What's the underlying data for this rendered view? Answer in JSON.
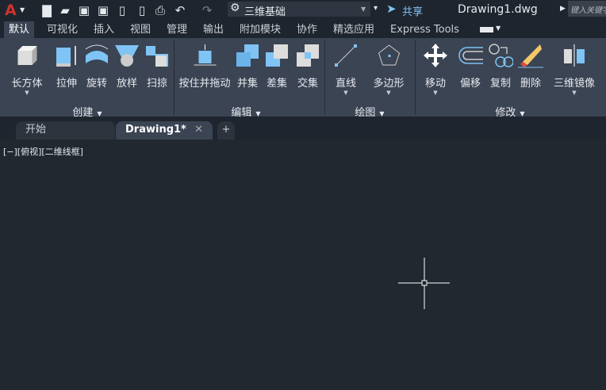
{
  "titlebar": {
    "app_logo": "A",
    "workspace": "三维基础",
    "share": "共享",
    "doc_title": "Drawing1.dwg",
    "search_placeholder": "键入关键字"
  },
  "ribbon_tabs": [
    "默认",
    "可视化",
    "插入",
    "视图",
    "管理",
    "输出",
    "附加模块",
    "协作",
    "精选应用",
    "Express Tools"
  ],
  "panels": {
    "create": {
      "label": "创建",
      "buttons": [
        "长方体",
        "拉伸",
        "旋转",
        "放样",
        "扫掠"
      ]
    },
    "edit": {
      "label": "编辑",
      "buttons": [
        "按住并拖动",
        "并集",
        "差集",
        "交集"
      ]
    },
    "draw": {
      "label": "绘图",
      "buttons": [
        "直线",
        "多边形"
      ]
    },
    "modify": {
      "label": "修改",
      "buttons": [
        "移动",
        "偏移",
        "复制",
        "删除",
        "三维镜像"
      ]
    }
  },
  "doc_tabs": {
    "start": "开始",
    "drawing": "Drawing1*",
    "close": "✕",
    "new": "+"
  },
  "viewport_label": "[−][俯视][二维线框]",
  "colors": {
    "accent": "#7fc4f5",
    "logo": "#d0312d"
  }
}
